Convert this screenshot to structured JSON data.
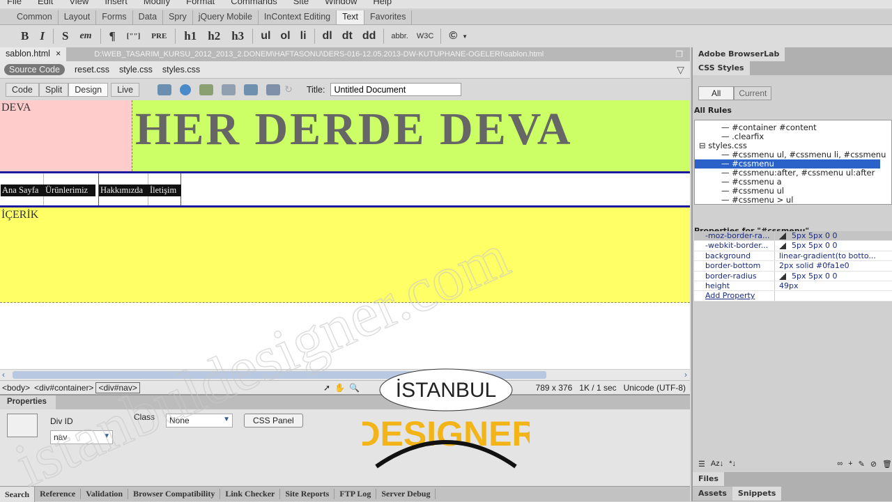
{
  "menu": [
    "File",
    "Edit",
    "View",
    "Insert",
    "Modify",
    "Format",
    "Commands",
    "Site",
    "Window",
    "Help"
  ],
  "insert_tabs": {
    "items": [
      "Common",
      "Layout",
      "Forms",
      "Data",
      "Spry",
      "jQuery Mobile",
      "InContext Editing",
      "Text",
      "Favorites"
    ],
    "active": "Text"
  },
  "text_toolbar": {
    "bold": "B",
    "italic": "I",
    "strong": "S",
    "em": "em",
    "paragraph": "¶",
    "blockquote": "[\"\"]",
    "pre": "PRE",
    "h1": "h1",
    "h2": "h2",
    "h3": "h3",
    "ul": "ul",
    "ol": "ol",
    "li": "li",
    "dl": "dl",
    "dt": "dt",
    "dd": "dd",
    "abbr": "abbr.",
    "w3c": "W3C",
    "characters": "©"
  },
  "document": {
    "tab_label": "sablon.html",
    "close": "×",
    "path": "D:\\WEB_TASARIM_KURSU_2012_2013_2.DONEM\\HAFTASONU\\DERS-016-12.05.2013-DW-KUTUPHANE-OGELERI\\sablon.html",
    "related_files": [
      "Source Code",
      "reset.css",
      "style.css",
      "styles.css"
    ],
    "views": [
      "Code",
      "Split",
      "Design",
      "Live"
    ],
    "active_view": "Design",
    "title_label": "Title:",
    "title_value": "Untitled Document"
  },
  "design": {
    "logo_box": "DEVA",
    "banner": "HER DERDE DEVA",
    "nav": [
      "Ana Sayfa",
      "Ürünlerimiz",
      "Hakkımızda",
      "İletişim"
    ],
    "content": "İÇERİK",
    "colors": {
      "pink": "#ffcccc",
      "green": "#ccff66",
      "yellow": "#ffff66",
      "nav_border": "#1a1aa0"
    }
  },
  "status": {
    "tags": [
      "<body>",
      "<div#container>",
      "<div#nav>"
    ],
    "selected_tag": "<div#nav>",
    "size": "789 x 376",
    "download": "1K / 1 sec",
    "encoding": "Unicode (UTF-8)"
  },
  "properties": {
    "title": "Properties",
    "div_id_label": "Div ID",
    "div_id_value": "nav",
    "class_label": "Class",
    "class_value": "None",
    "css_panel": "CSS Panel"
  },
  "bottom_tabs": {
    "items": [
      "Search",
      "Reference",
      "Validation",
      "Browser Compatibility",
      "Link Checker",
      "Site Reports",
      "FTP Log",
      "Server Debug"
    ],
    "active": "Search"
  },
  "right_panel": {
    "browserlab": "Adobe BrowserLab",
    "css_styles": "CSS Styles",
    "mode_buttons": [
      "All",
      "Current"
    ],
    "active_mode": "All",
    "all_rules_label": "All Rules",
    "rules": [
      {
        "text": "#container #content",
        "indent": 2
      },
      {
        "text": ".clearfix",
        "indent": 2
      },
      {
        "text": "styles.css",
        "indent": 1,
        "expander": "⊟"
      },
      {
        "text": "#cssmenu ul, #cssmenu li, #cssmenu",
        "indent": 2
      },
      {
        "text": "#cssmenu",
        "indent": 2,
        "selected": true
      },
      {
        "text": "#cssmenu:after, #cssmenu ul:after",
        "indent": 2
      },
      {
        "text": "#cssmenu a",
        "indent": 2
      },
      {
        "text": "#cssmenu ul",
        "indent": 2
      },
      {
        "text": "#cssmenu > ul",
        "indent": 2
      }
    ],
    "props_title": "Properties for \"#cssmenu\"",
    "props": [
      {
        "name": "-moz-border-ra...",
        "value": "5px 5px 0 0",
        "icon": true
      },
      {
        "name": "-webkit-border...",
        "value": "5px 5px 0 0",
        "icon": true
      },
      {
        "name": "background",
        "value": "linear-gradient(to botto..."
      },
      {
        "name": "border-bottom",
        "value": "2px solid #0fa1e0"
      },
      {
        "name": "border-radius",
        "value": "5px 5px 0 0",
        "icon": true
      },
      {
        "name": "height",
        "value": "49px"
      }
    ],
    "add_property": "Add Property",
    "files": "Files",
    "assets_tabs": [
      "Assets",
      "Snippets"
    ],
    "active_assets_tab": "Snippets"
  },
  "overlay": {
    "logo_top": "İSTANBUL",
    "logo_bottom": "DESIGNER",
    "watermark": "istanbuldesigner.com"
  }
}
